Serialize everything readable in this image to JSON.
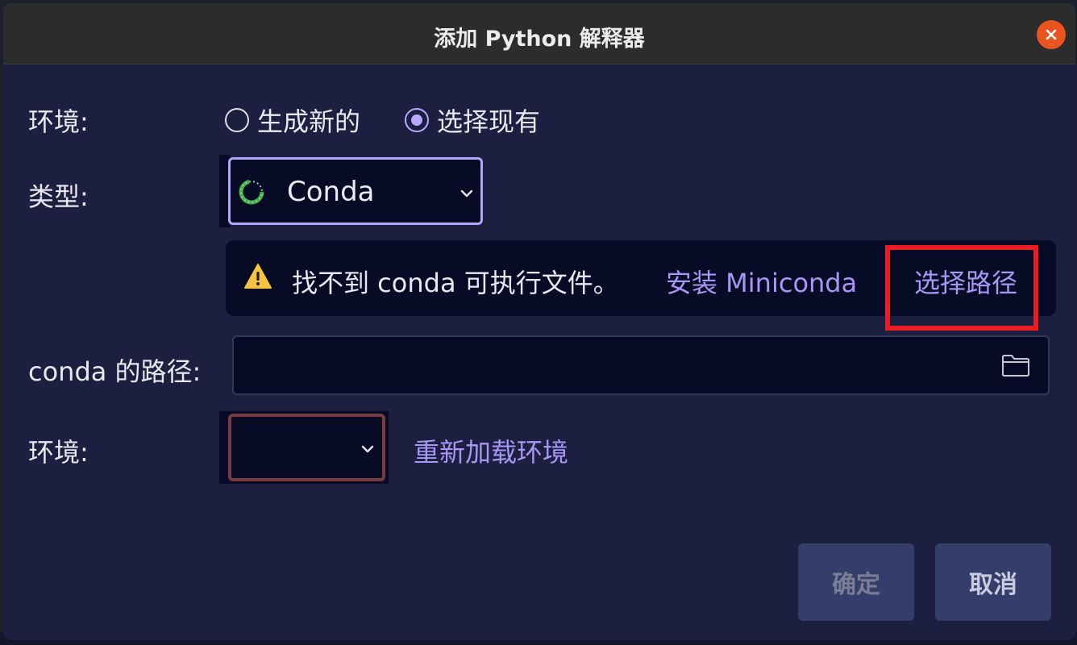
{
  "dialog": {
    "title": "添加 Python 解释器"
  },
  "environment_row": {
    "label": "环境:",
    "options": [
      {
        "label": "生成新的",
        "selected": false
      },
      {
        "label": "选择现有",
        "selected": true
      }
    ]
  },
  "type_row": {
    "label": "类型:",
    "value": "Conda"
  },
  "warning": {
    "message": "找不到 conda 可执行文件。",
    "install_link": "安装 Miniconda",
    "choose_path_link": "选择路径"
  },
  "conda_path": {
    "label": "conda 的路径:",
    "value": ""
  },
  "env_row": {
    "label": "环境:",
    "value": "",
    "reload_link": "重新加载环境"
  },
  "buttons": {
    "ok": "确定",
    "cancel": "取消"
  },
  "colors": {
    "accent": "#b3a4ff",
    "link": "#a996f4",
    "close": "#e9541f",
    "highlight": "#ec1c24",
    "warning": "#f5c542"
  }
}
